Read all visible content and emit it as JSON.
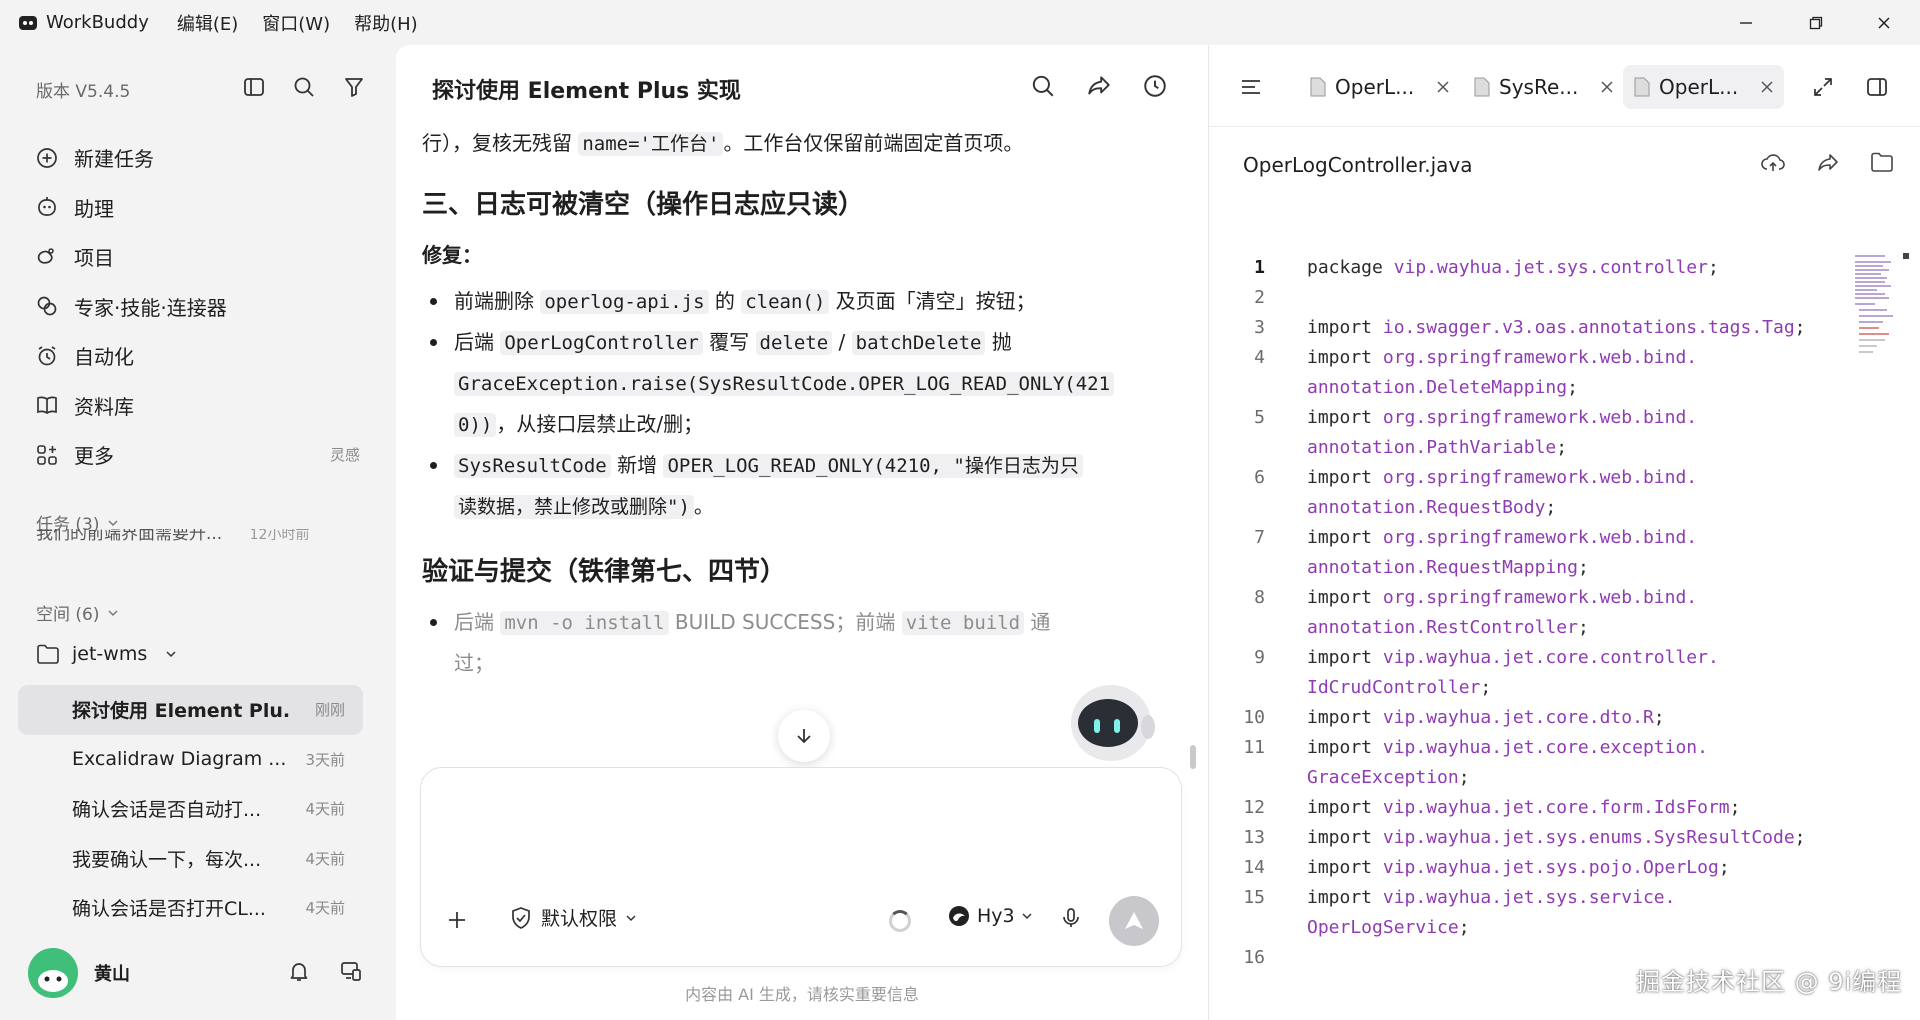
{
  "titlebar": {
    "app_name": "WorkBuddy",
    "menus": [
      "编辑(E)",
      "窗口(W)",
      "帮助(H)"
    ]
  },
  "sidebar": {
    "version": "版本 V5.4.5",
    "nav": [
      {
        "label": "新建任务",
        "icon": "plus-circle-icon"
      },
      {
        "label": "助理",
        "icon": "assistant-icon"
      },
      {
        "label": "项目",
        "icon": "project-icon"
      },
      {
        "label": "专家·技能·连接器",
        "icon": "expert-icon"
      },
      {
        "label": "自动化",
        "icon": "alarm-icon"
      },
      {
        "label": "资料库",
        "icon": "book-icon"
      },
      {
        "label": "更多",
        "icon": "apps-icon",
        "hint": "灵感"
      }
    ],
    "tasks_label": "任务 (3)",
    "clipped_task": "我们的前端界面需要升...",
    "clipped_task_time": "12小时前",
    "spaces_label": "空间 (6)",
    "folder": "jet-wms",
    "sessions": [
      {
        "title": "探讨使用 Element Plu...",
        "time": "刚刚"
      },
      {
        "title": "Excalidraw Diagram ...",
        "time": "3天前"
      },
      {
        "title": "确认会话是否自动打...",
        "time": "4天前"
      },
      {
        "title": "我要确认一下，每次...",
        "time": "4天前"
      },
      {
        "title": "确认会话是否打开CL...",
        "time": "4天前"
      }
    ],
    "user": "黄山"
  },
  "chat": {
    "title": "探讨使用 Element Plus 实现",
    "p1_a": "行），复核无残留 ",
    "p1_code": "name='工作台'",
    "p1_b": "。工作台仅保留前端固定首页项。",
    "h_section3": "三、日志可被清空（操作日志应只读）",
    "fix_label": "修复：",
    "b1_a": "前端删除 ",
    "b1_code1": "operlog-api.js",
    "b1_b": " 的 ",
    "b1_code2": "clean()",
    "b1_c": " 及页面「清空」按钮；",
    "b2_a": "后端 ",
    "b2_code1": "OperLogController",
    "b2_b": " 覆写 ",
    "b2_code2": "delete",
    "b2_c": " / ",
    "b2_code3": "batchDelete",
    "b2_d": " 抛",
    "b2_code4": "GraceException.raise(SysResultCode.OPER_LOG_READ_ONLY(421",
    "b2_code5": "0))",
    "b2_e": "，从接口层禁止改/删；",
    "b3_code1": "SysResultCode",
    "b3_a": " 新增 ",
    "b3_code2": "OPER_LOG_READ_ONLY(4210, \"操作日志为只",
    "b3_code3": "读数据，禁止修改或删除\")",
    "b3_b": "。",
    "h_verify": "验证与提交（铁律第七、四节）",
    "b4_a": "后端 ",
    "b4_code1": "mvn -o install",
    "b4_b": " BUILD SUCCESS；前端 ",
    "b4_code2": "vite build",
    "b4_c": " 通",
    "b4_d": "过；",
    "input_placeholder": "",
    "permission": "默认权限",
    "model": "Hy3",
    "disclaimer": "内容由 AI 生成，请核实重要信息"
  },
  "code": {
    "tabs": [
      "OperL...",
      "SysRe...",
      "OperL..."
    ],
    "file_name": "OperLogController.java",
    "lines": [
      {
        "n": "1",
        "kw": "package ",
        "pkg": "vip.wayhua.jet.sys.controller",
        "tail": ";"
      },
      {
        "n": "2",
        "kw": "",
        "pkg": "",
        "tail": ""
      },
      {
        "n": "3",
        "kw": "import ",
        "pkg": "io.swagger.v3.oas.annotations.tags.Tag",
        "tail": ";"
      },
      {
        "n": "4",
        "kw": "import ",
        "pkg": "org.springframework.web.bind.",
        "tail": ""
      },
      {
        "n": "",
        "kw": "",
        "pkg": "annotation.DeleteMapping",
        "tail": ";"
      },
      {
        "n": "5",
        "kw": "import ",
        "pkg": "org.springframework.web.bind.",
        "tail": ""
      },
      {
        "n": "",
        "kw": "",
        "pkg": "annotation.PathVariable",
        "tail": ";"
      },
      {
        "n": "6",
        "kw": "import ",
        "pkg": "org.springframework.web.bind.",
        "tail": ""
      },
      {
        "n": "",
        "kw": "",
        "pkg": "annotation.RequestBody",
        "tail": ";"
      },
      {
        "n": "7",
        "kw": "import ",
        "pkg": "org.springframework.web.bind.",
        "tail": ""
      },
      {
        "n": "",
        "kw": "",
        "pkg": "annotation.RequestMapping",
        "tail": ";"
      },
      {
        "n": "8",
        "kw": "import ",
        "pkg": "org.springframework.web.bind.",
        "tail": ""
      },
      {
        "n": "",
        "kw": "",
        "pkg": "annotation.RestController",
        "tail": ";"
      },
      {
        "n": "9",
        "kw": "import ",
        "pkg": "vip.wayhua.jet.core.controller.",
        "tail": ""
      },
      {
        "n": "",
        "kw": "",
        "pkg": "IdCrudController",
        "tail": ";"
      },
      {
        "n": "10",
        "kw": "import ",
        "pkg": "vip.wayhua.jet.core.dto.R",
        "tail": ";"
      },
      {
        "n": "11",
        "kw": "import ",
        "pkg": "vip.wayhua.jet.core.exception.",
        "tail": ""
      },
      {
        "n": "",
        "kw": "",
        "pkg": "GraceException",
        "tail": ";"
      },
      {
        "n": "12",
        "kw": "import ",
        "pkg": "vip.wayhua.jet.core.form.IdsForm",
        "tail": ";"
      },
      {
        "n": "13",
        "kw": "import ",
        "pkg": "vip.wayhua.jet.sys.enums.SysResultCode",
        "tail": ";"
      },
      {
        "n": "14",
        "kw": "import ",
        "pkg": "vip.wayhua.jet.sys.pojo.OperLog",
        "tail": ";"
      },
      {
        "n": "15",
        "kw": "import ",
        "pkg": "vip.wayhua.jet.sys.service.",
        "tail": ""
      },
      {
        "n": "",
        "kw": "",
        "pkg": "OperLogService",
        "tail": ";"
      },
      {
        "n": "16",
        "kw": "",
        "pkg": "",
        "tail": ""
      }
    ]
  },
  "watermark": "掘金技术社区 @ 9i编程",
  "colors": {
    "package": "#8f3bb3",
    "active_session": "#e3e3e6",
    "send_button": "#c8c8cc"
  }
}
